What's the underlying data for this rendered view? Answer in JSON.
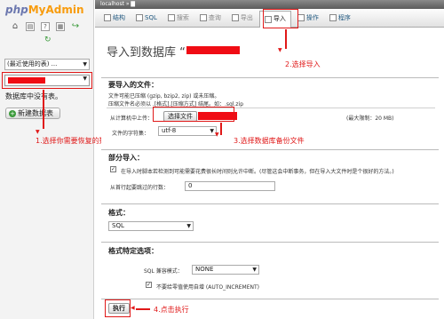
{
  "logo": {
    "php": "php",
    "my": "My",
    "admin": "Admin"
  },
  "sidebar": {
    "recent_label": "(最近使用的表) ...",
    "no_db_text": "数据库中没有表。",
    "new_table_label": "新建数据表"
  },
  "topbar": {
    "breadcrumb": "localhost » ▇"
  },
  "tabs": [
    {
      "label": "结构"
    },
    {
      "label": "SQL"
    },
    {
      "label": "搜索"
    },
    {
      "label": "查询"
    },
    {
      "label": "导出"
    },
    {
      "label": "导入"
    },
    {
      "label": "操作"
    },
    {
      "label": "程序"
    }
  ],
  "page": {
    "title": "导入到数据库 “"
  },
  "file_section": {
    "legend": "要导入的文件：",
    "compress_note": "文件可能已压缩 (gzip, bzip2, zip) 或未压缩。",
    "ext_note": "压缩文件名必须以 .[格式].[压缩方式] 结尾。如：.sql.zip",
    "upload_label": "从计算机中上传：",
    "choose_button": "选择文件",
    "max_size": "(最大限制：20 MB)",
    "charset_label": "文件的字符集：",
    "charset_value": "utf-8"
  },
  "partial_section": {
    "legend": "部分导入：",
    "interrupt_text": "在导入时脚本若检测到可能需要花费很长时间则允许中断。(尽管这会中断事务，但在导入大文件时是个很好的方法。)",
    "skip_label": "从首行起要跳过的行数：",
    "skip_value": "0"
  },
  "format_section": {
    "legend": "格式：",
    "format_value": "SQL"
  },
  "options_section": {
    "legend": "格式特定选项：",
    "compat_label": "SQL 兼容模式：",
    "compat_value": "NONE",
    "auto_inc_text": "不要给零值使用自增 (AUTO_INCREMENT)"
  },
  "go_button": "执行",
  "annotations": {
    "step1": "1.选择你需要恢复的数据库",
    "step2": "2.选择导入",
    "step3": "3.选择数据库备份文件",
    "step4": "4.点击执行"
  },
  "colors": {
    "annotation": "#e01818",
    "redact": "#f00c14",
    "link": "#235a81"
  }
}
